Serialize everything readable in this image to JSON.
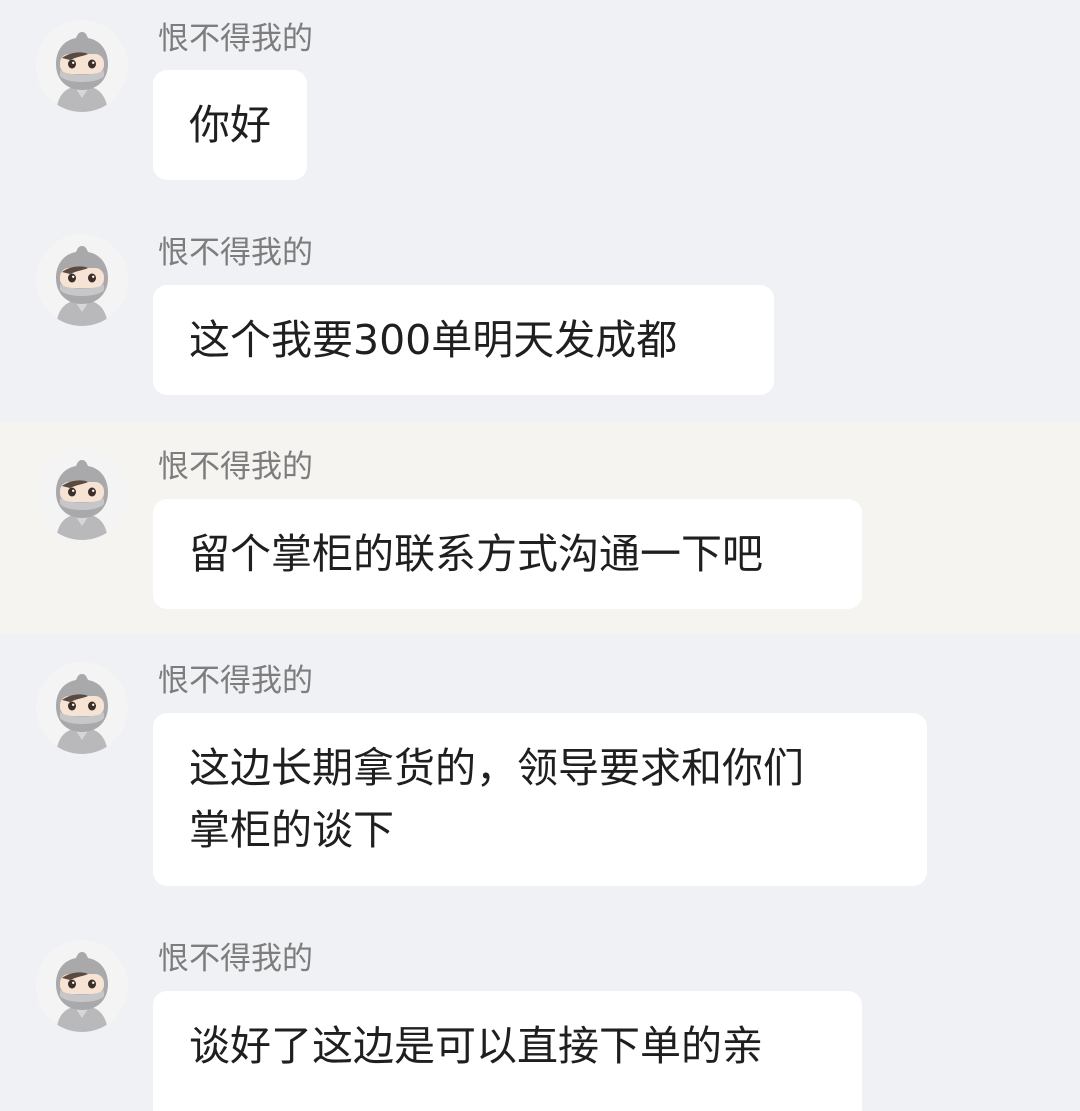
{
  "chat": {
    "messages": [
      {
        "sender": "恨不得我的",
        "lines": [
          "你好"
        ]
      },
      {
        "sender": "恨不得我的",
        "lines": [
          "这个我要300单明天发成都"
        ]
      },
      {
        "sender": "恨不得我的",
        "lines": [
          "留个掌柜的联系方式沟通一下吧"
        ],
        "highlighted": true
      },
      {
        "sender": "恨不得我的",
        "lines": [
          "这边长期拿货的，领导要求和你们",
          "掌柜的谈下"
        ]
      },
      {
        "sender": "恨不得我的",
        "lines": [
          "谈好了这边是可以直接下单的亲"
        ]
      }
    ]
  },
  "icons": {
    "avatar": "ninja-avatar-icon"
  },
  "colors": {
    "background": "#f0f1f5",
    "highlight_row": "#f5f4f0",
    "bubble": "#ffffff",
    "sender_text": "#7d7d7d",
    "message_text": "#1f1f1f"
  }
}
